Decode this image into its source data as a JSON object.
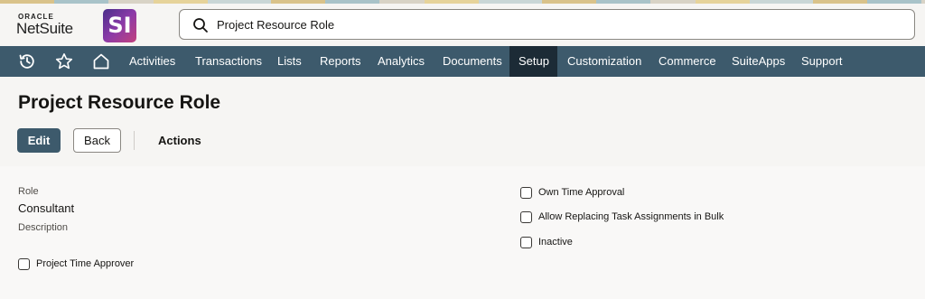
{
  "header": {
    "logo_oracle": "ORACLE",
    "logo_netsuite": "NetSuite",
    "logo_badge": "SI",
    "search_value": "Project Resource Role"
  },
  "navbar": {
    "icons": [
      "history-icon",
      "star-icon",
      "home-icon"
    ],
    "items": [
      {
        "label": "Activities"
      },
      {
        "label": "Transactions"
      },
      {
        "label": "Lists"
      },
      {
        "label": "Reports"
      },
      {
        "label": "Analytics"
      },
      {
        "label": "Documents"
      },
      {
        "label": "Setup",
        "active": true
      },
      {
        "label": "Customization"
      },
      {
        "label": "Commerce"
      },
      {
        "label": "SuiteApps"
      },
      {
        "label": "Support"
      }
    ],
    "bg_color": "#3d5a6c",
    "active_color": "#1c2b36"
  },
  "page": {
    "title": "Project Resource Role",
    "edit_label": "Edit",
    "back_label": "Back",
    "actions_label": "Actions"
  },
  "form": {
    "role_label": "Role",
    "role_value": "Consultant",
    "description_label": "Description",
    "checkboxes": [
      {
        "label": "Project Time Approver",
        "checked": false
      },
      {
        "label": "Own Time Approval",
        "checked": false
      },
      {
        "label": "Allow Replacing Task Assignments in Bulk",
        "checked": false
      },
      {
        "label": "Inactive",
        "checked": false
      }
    ]
  }
}
